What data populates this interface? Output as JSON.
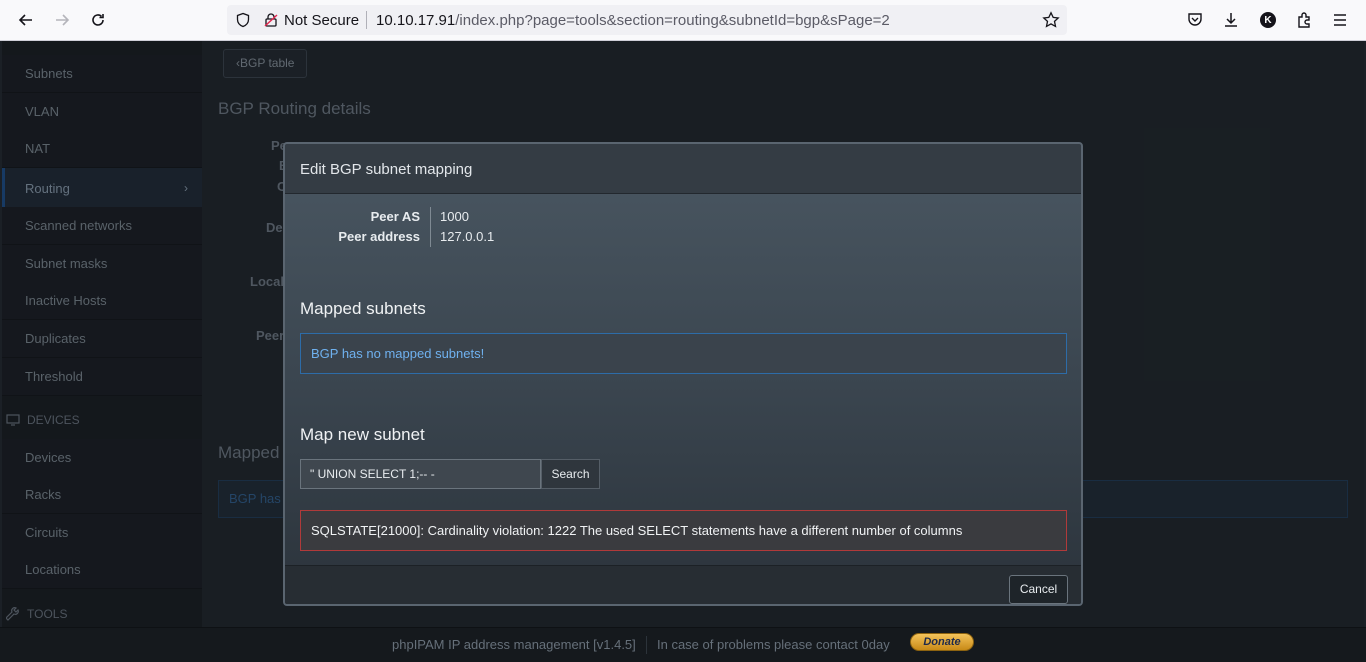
{
  "browser": {
    "not_secure_label": "Not Secure",
    "url_host": "10.10.17.91",
    "url_path": "/index.php?page=tools&section=routing&subnetId=bgp&sPage=2",
    "profile_initial": "K"
  },
  "sidebar": {
    "items": [
      {
        "label": "Subnets"
      },
      {
        "label": "VLAN"
      },
      {
        "label": "NAT"
      },
      {
        "label": "Routing"
      },
      {
        "label": "Scanned networks"
      },
      {
        "label": "Subnet masks"
      },
      {
        "label": "Inactive Hosts"
      },
      {
        "label": "Duplicates"
      },
      {
        "label": "Threshold"
      }
    ],
    "devices_header": "DEVICES",
    "device_items": [
      {
        "label": "Devices"
      },
      {
        "label": "Racks"
      },
      {
        "label": "Circuits"
      },
      {
        "label": "Locations"
      }
    ],
    "tools_header": "TOOLS"
  },
  "main": {
    "back_button": "BGP table",
    "title": "BGP Routing details",
    "label_peer_as_partial": "Pe",
    "label_b_partial": "B",
    "label_c_partial": "C",
    "label_de_partial": "De",
    "label_local_partial": "Local",
    "label_peer_partial": "Peer",
    "mapped_title_partial": "Mapped s",
    "bg_info_partial": "BGP has"
  },
  "modal": {
    "title": "Edit BGP subnet mapping",
    "peer_as_label": "Peer AS",
    "peer_as_value": "1000",
    "peer_address_label": "Peer address",
    "peer_address_value": "127.0.0.1",
    "mapped_heading": "Mapped subnets",
    "no_mapped_msg": "BGP has no mapped subnets!",
    "map_new_heading": "Map new subnet",
    "search_value": "\" UNION SELECT 1;-- -",
    "search_button": "Search",
    "error_msg": "SQLSTATE[21000]: Cardinality violation: 1222 The used SELECT statements have a different number of columns",
    "cancel_button": "Cancel"
  },
  "footer": {
    "app_text": "phpIPAM IP address management [v1.4.5]",
    "contact_text": "In case of problems please contact 0day",
    "donate_label": "Donate"
  }
}
